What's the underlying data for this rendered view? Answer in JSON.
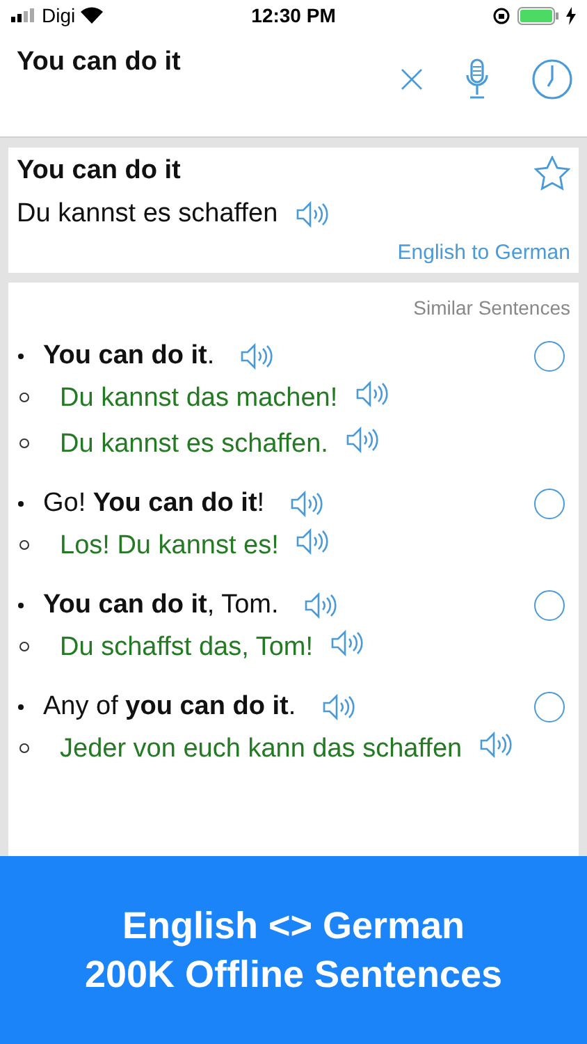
{
  "status_bar": {
    "carrier": "Digi",
    "time": "12:30 PM"
  },
  "search": {
    "value": "You can do it"
  },
  "result": {
    "source": "You can do it",
    "translation": "Du kannst es schaffen",
    "favorite": false,
    "direction": "English to German"
  },
  "similar": {
    "title": "Similar Sentences",
    "items": [
      {
        "text": "**You can do it**.",
        "selected": false,
        "translations": [
          "Du kannst das machen!",
          "Du kannst es schaffen."
        ]
      },
      {
        "text": "Go! **You can do it**!",
        "selected": false,
        "translations": [
          "Los! Du kannst es!"
        ]
      },
      {
        "text": "**You can do it**, Tom.",
        "selected": false,
        "translations": [
          "Du schaffst das, Tom!"
        ]
      },
      {
        "text": "Any of **you can do it**.",
        "selected": false,
        "translations": [
          "Jeder von euch kann das schaffen"
        ]
      }
    ]
  },
  "banner": {
    "lines": [
      "English <> German",
      "200K Offline Sentences"
    ]
  }
}
